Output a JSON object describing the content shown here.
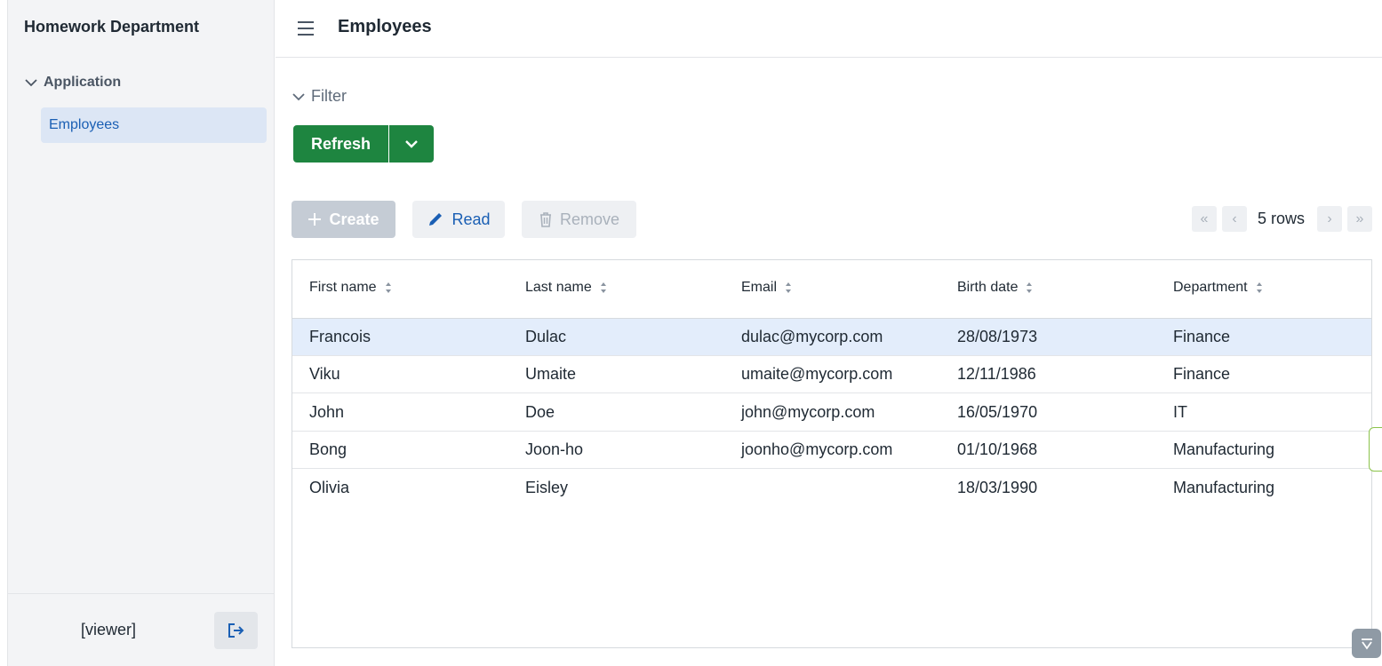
{
  "app": {
    "title": "Homework Department"
  },
  "sidebar": {
    "group_label": "Application",
    "items": [
      {
        "label": "Employees",
        "active": true
      }
    ],
    "user_label": "[viewer]"
  },
  "header": {
    "title": "Employees"
  },
  "filter": {
    "label": "Filter"
  },
  "actions": {
    "refresh_label": "Refresh",
    "create_label": "Create",
    "read_label": "Read",
    "remove_label": "Remove"
  },
  "pager": {
    "rows_label": "5 rows"
  },
  "table": {
    "columns": [
      "First name",
      "Last name",
      "Email",
      "Birth date",
      "Department"
    ],
    "rows": [
      {
        "first": "Francois",
        "last": "Dulac",
        "email": "dulac@mycorp.com",
        "birth": "28/08/1973",
        "dept": "Finance",
        "selected": true
      },
      {
        "first": "Viku",
        "last": "Umaite",
        "email": "umaite@mycorp.com",
        "birth": "12/11/1986",
        "dept": "Finance"
      },
      {
        "first": "John",
        "last": "Doe",
        "email": "john@mycorp.com",
        "birth": "16/05/1970",
        "dept": "IT"
      },
      {
        "first": "Bong",
        "last": "Joon-ho",
        "email": "joonho@mycorp.com",
        "birth": "01/10/1968",
        "dept": "Manufacturing"
      },
      {
        "first": "Olivia",
        "last": "Eisley",
        "email": "",
        "birth": "18/03/1990",
        "dept": "Manufacturing"
      }
    ]
  },
  "colors": {
    "primary_green": "#1e8540",
    "accent_blue": "#1a5fb4",
    "selected_row": "#e3edfb"
  }
}
